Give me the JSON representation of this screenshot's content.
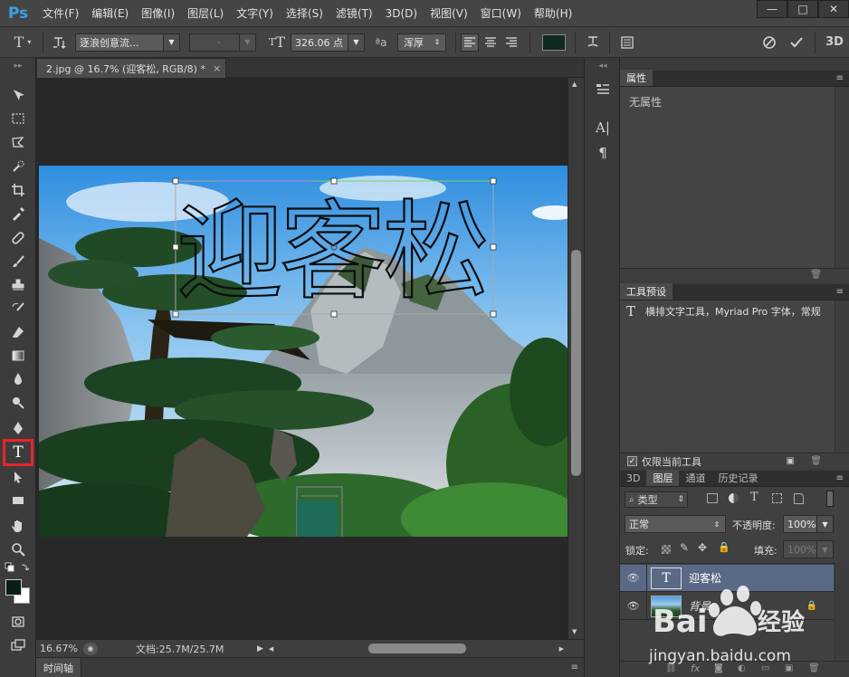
{
  "app": {
    "logo": "Ps"
  },
  "menu": [
    "文件(F)",
    "编辑(E)",
    "图像(I)",
    "图层(L)",
    "文字(Y)",
    "选择(S)",
    "滤镜(T)",
    "3D(D)",
    "视图(V)",
    "窗口(W)",
    "帮助(H)"
  ],
  "window_controls": {
    "minimize": "—",
    "restore": "□",
    "close": "✕"
  },
  "options": {
    "font_family": "逐浪创意流...",
    "font_style": "-",
    "font_size": "326.06 点",
    "aa_label": "ªa",
    "antialias": "浑厚",
    "text_color": "#0f2a1e",
    "threed": "3D"
  },
  "document": {
    "tab_title": "2.jpg @ 16.7% (迎客松, RGB/8) *",
    "tab_close": "×",
    "text_layer_text": "迎客松"
  },
  "status": {
    "zoom": "16.67%",
    "doc_info": "文档:25.7M/25.7M"
  },
  "timeline": {
    "tab": "时间轴"
  },
  "properties": {
    "tab": "属性",
    "body": "无属性"
  },
  "tool_presets": {
    "tab": "工具预设",
    "item": "横排文字工具，Myriad Pro 字体，常规",
    "current_only": "仅限当前工具"
  },
  "layers_panel": {
    "tabs": [
      "3D",
      "图层",
      "通道",
      "历史记录"
    ],
    "active_tab": "图层",
    "filter": "类型",
    "blend_mode": "正常",
    "opacity_label": "不透明度:",
    "opacity_value": "100%",
    "lock_label": "锁定:",
    "fill_label": "填充:",
    "fill_value": "100%",
    "layers": [
      {
        "name": "迎客松",
        "type": "text",
        "selected": true
      },
      {
        "name": "背景",
        "type": "image",
        "selected": false,
        "locked": true
      }
    ]
  },
  "watermark": {
    "brand": "Bai",
    "brand2": "经验",
    "url": "jingyan.baidu.com"
  },
  "colors": {
    "accent": "#3aa0e8",
    "highlight": "#e8242a",
    "selected_layer": "#5a6a86"
  }
}
